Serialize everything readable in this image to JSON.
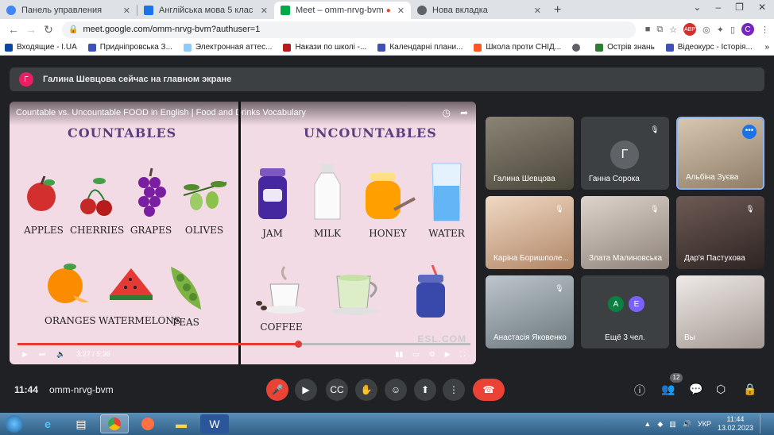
{
  "browser": {
    "tabs": [
      {
        "title": "Панель управления",
        "favicon_color": "#4285f4"
      },
      {
        "title": "Англійська мова 5 клас",
        "favicon_color": "#1a73e8"
      },
      {
        "title": "Meet – omm-nrvg-bvm",
        "favicon_color": "#00ac47"
      },
      {
        "title": "Нова вкладка",
        "favicon_color": "#5f6368"
      }
    ],
    "new_tab": "+",
    "url": "meet.google.com/omm-nrvg-bvm?authuser=1",
    "profile_initial": "C",
    "abp_badge": "ABP",
    "bookmarks": [
      {
        "label": "Входящие - I.UA",
        "color": "#0d47a1"
      },
      {
        "label": "Придніпровська З...",
        "color": "#3f51b5"
      },
      {
        "label": "Электронная аттес...",
        "color": "#90caf9"
      },
      {
        "label": "Накази по школі -...",
        "color": "#b71c1c"
      },
      {
        "label": "Календарні плани...",
        "color": "#3f51b5"
      },
      {
        "label": "Школа проти СНІД...",
        "color": "#ff5722"
      },
      {
        "label": "",
        "color": "#5f6368"
      },
      {
        "label": "Острів знань",
        "color": "#2e7d32"
      },
      {
        "label": "Відеокурс - Історія...",
        "color": "#3f51b5"
      }
    ],
    "bookmarks_more": "»"
  },
  "meet": {
    "banner": {
      "avatar": "Г",
      "text": "Галина Шевцова сейчас на главном экране"
    },
    "video": {
      "title": "Countable vs. Uncountable FOOD in English | Food and Drinks Vocabulary",
      "countables_heading": "COUNTABLES",
      "uncountables_heading": "UNCOUNTABLES",
      "countables": [
        "APPLES",
        "CHERRIES",
        "GRAPES",
        "OLIVES",
        "ORANGES",
        "WATERMELONS",
        "PEAS"
      ],
      "uncountables": [
        "JAM",
        "MILK",
        "HONEY",
        "WATER",
        "COFFEE",
        "",
        ""
      ],
      "time_current": "3:27",
      "time_total": "5:36",
      "progress": 0.62,
      "watermark": "ESL.COM"
    },
    "participants": [
      {
        "name": "Галина Шевцова",
        "type": "photo",
        "muted": false,
        "color": "#6d6a5f"
      },
      {
        "name": "Ганна Сорока",
        "type": "avatar",
        "initial": "Г",
        "muted": true,
        "color": "#5f6368"
      },
      {
        "name": "Альбіна Зуєва",
        "type": "photo",
        "muted": false,
        "color": "#b8a488",
        "selected": true
      },
      {
        "name": "Каріна Боришполе...",
        "type": "photo",
        "muted": true,
        "color": "#cfa98a"
      },
      {
        "name": "Злата Малиновська",
        "type": "photo",
        "muted": true,
        "color": "#c3b7ac"
      },
      {
        "name": "Дар'я Пастухова",
        "type": "photo",
        "muted": true,
        "color": "#5b4a45"
      },
      {
        "name": "Анастасія Яковенко",
        "type": "photo",
        "muted": true,
        "color": "#9aa5ac"
      },
      {
        "name": "Ещё 3 чел.",
        "type": "more",
        "avatars": [
          "А",
          "Е"
        ]
      },
      {
        "name": "Вы",
        "type": "photo",
        "muted": false,
        "color": "#d9d3cf"
      }
    ],
    "time": "11:44",
    "code": "omm-nrvg-bvm",
    "people_count": "12"
  },
  "taskbar": {
    "language": "УКР",
    "time": "11:44",
    "date": "13.02.2023"
  }
}
